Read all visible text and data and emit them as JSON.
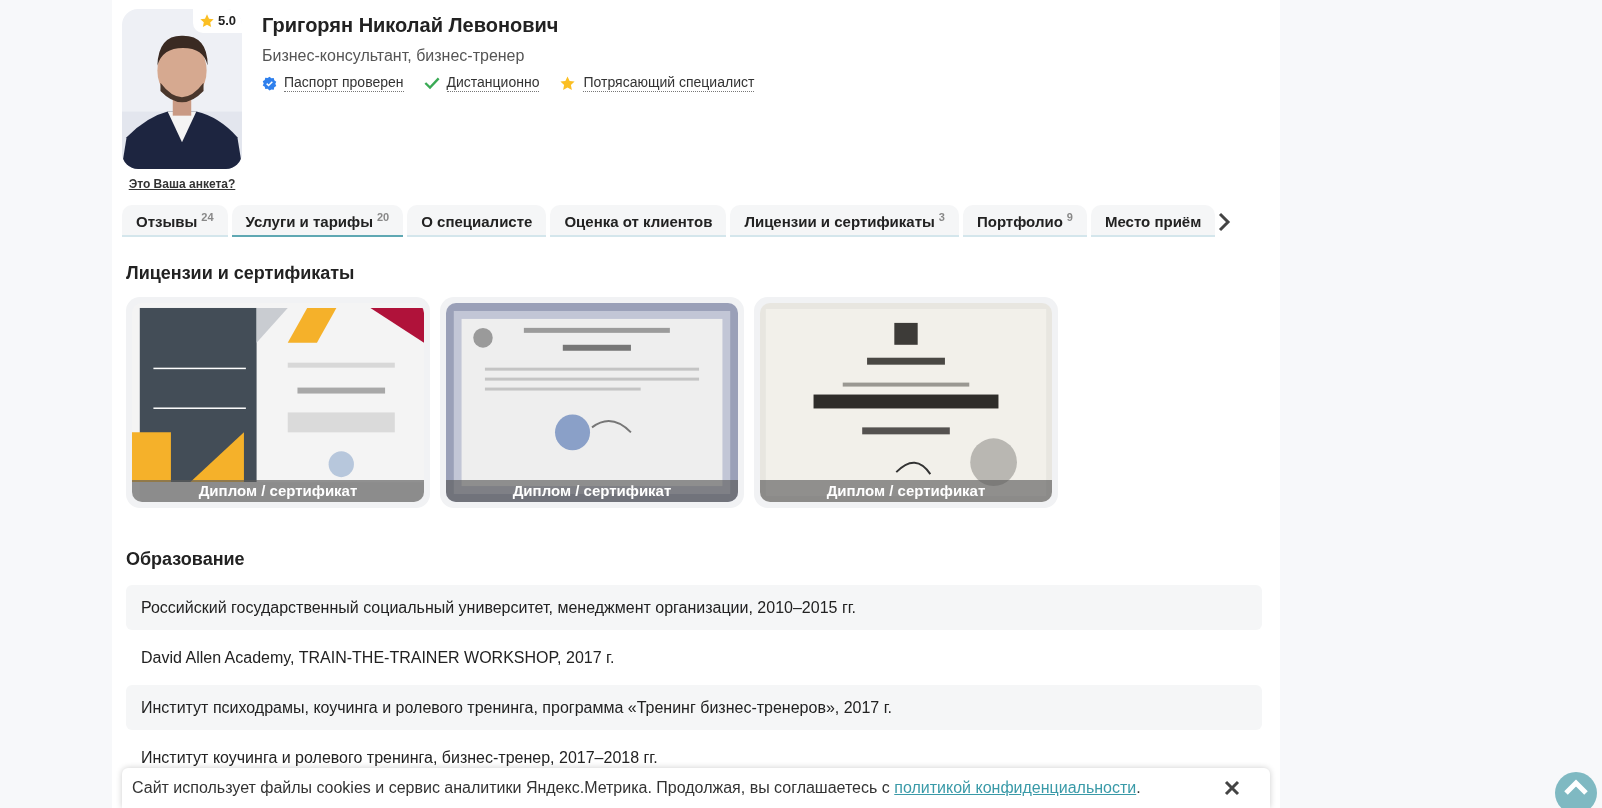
{
  "profile": {
    "rating": "5.0",
    "name": "Григорян Николай Левонович",
    "title": "Бизнес-консультант, бизнес-тренер",
    "badges": [
      {
        "kind": "verified",
        "label": "Паспорт проверен"
      },
      {
        "kind": "check",
        "label": "Дистанционно"
      },
      {
        "kind": "star",
        "label": "Потрясающий специалист"
      }
    ],
    "claim_link": "Это Ваша анкета?"
  },
  "tabs": [
    {
      "label": "Отзывы",
      "count": "24",
      "selected": false
    },
    {
      "label": "Услуги и тарифы",
      "count": "20",
      "selected": true
    },
    {
      "label": "О специалисте",
      "selected": false
    },
    {
      "label": "Оценка от клиентов",
      "selected": false
    },
    {
      "label": "Лицензии и сертификаты",
      "count": "3",
      "selected": false
    },
    {
      "label": "Портфолио",
      "count": "9",
      "selected": false
    },
    {
      "label": "Место приём",
      "selected": false
    }
  ],
  "certificates": {
    "title": "Лицензии и сертификаты",
    "items": [
      {
        "kind": "picture",
        "caption": "Диплом / сертификат"
      },
      {
        "kind": "picture",
        "caption": "Диплом / сертификат"
      },
      {
        "kind": "picture",
        "caption": "Диплом / сертификат"
      }
    ]
  },
  "education": {
    "title": "Образование",
    "rows": [
      "Российский государственный социальный университет, менеджмент организации, 2010–2015 гг.",
      "David Allen Academy, TRAIN-THE-TRAINER WORKSHOP, 2017 г.",
      "Институт психодрамы, коучинга и ролевого тренинга, программа «Тренинг бизнес-тренеров», 2017 г.",
      "Институт коучинга и ролевого тренинга, бизнес-тренер, 2017–2018 гг."
    ]
  },
  "cookie_banner": {
    "text": "Сайт использует файлы cookies и сервис аналитики Яндекс.Метрика. Продолжая, вы соглашаетесь с",
    "link": "политикой конфиденциальности",
    "suffix": "."
  }
}
